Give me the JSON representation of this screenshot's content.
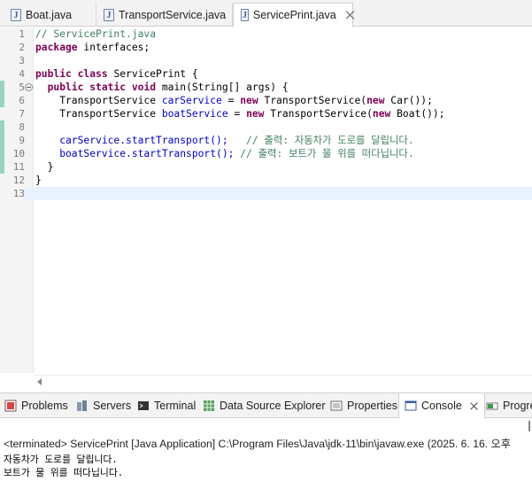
{
  "editor_tabs": [
    {
      "label": "Boat.java",
      "icon": "java-file-icon",
      "active": false
    },
    {
      "label": "TransportService.java",
      "icon": "java-file-icon",
      "active": false
    },
    {
      "label": "ServicePrint.java",
      "icon": "java-file-icon",
      "active": true
    }
  ],
  "java_icon_glyph": "J",
  "code": {
    "line_numbers": [
      "1",
      "2",
      "3",
      "4",
      "5",
      "6",
      "7",
      "8",
      "9",
      "10",
      "11",
      "12",
      "13"
    ],
    "lines": [
      "// ServicePrint.java",
      "package interfaces;",
      "",
      "public class ServicePrint {",
      "  public static void main(String[] args) {",
      "    TransportService carService = new TransportService(new Car());",
      "    TransportService boatService = new TransportService(new Boat());",
      "",
      "    carService.startTransport();   // 출력: 자동차가 도로를 달립니다.",
      "    boatService.startTransport(); // 출력: 보트가 물 위를 떠다닙니다.",
      "  }",
      "}",
      ""
    ],
    "tokens": {
      "l1_comment": "// ServicePrint.java",
      "l2_kw": "package",
      "l2_rest": " interfaces;",
      "l4_kw1": "public",
      "l4_kw2": "class",
      "l4_rest": " ServicePrint {",
      "l5_indent": "  ",
      "l5_kw1": "public",
      "l5_kw2": "static",
      "l5_kw3": "void",
      "l5_rest": " main(String[] args) {",
      "l6_a": "    TransportService ",
      "l6_var": "carService",
      "l6_b": " = ",
      "l6_kw": "new",
      "l6_c": " TransportService(",
      "l6_kw2": "new",
      "l6_d": " Car());",
      "l7_a": "    TransportService ",
      "l7_var": "boatService",
      "l7_b": " = ",
      "l7_kw": "new",
      "l7_c": " TransportService(",
      "l7_kw2": "new",
      "l7_d": " Boat());",
      "l9_a": "    carService.startTransport();   ",
      "l9_cm": "// 출력: 자동차가 도로를 달립니다.",
      "l10_a": "    boatService.startTransport(); ",
      "l10_cm": "// 출력: 보트가 물 위를 떠다닙니다.",
      "l11": "  }",
      "l12": "}"
    }
  },
  "view_tabs": [
    {
      "label": "Problems",
      "icon": "problems-icon"
    },
    {
      "label": "Servers",
      "icon": "servers-icon"
    },
    {
      "label": "Terminal",
      "icon": "terminal-icon"
    },
    {
      "label": "Data Source Explorer",
      "icon": "data-source-icon"
    },
    {
      "label": "Properties",
      "icon": "properties-icon"
    },
    {
      "label": "Console",
      "icon": "console-icon",
      "active": true
    },
    {
      "label": "Progre",
      "icon": "progress-icon"
    }
  ],
  "console": {
    "status": "<terminated> ServicePrint [Java Application] C:\\Program Files\\Java\\jdk-11\\bin\\javaw.exe  (2025. 6. 16. 오후",
    "output": [
      "자동차가 도로를 달립니다.",
      "보트가 물 위를 떠다닙니다."
    ]
  },
  "colors": {
    "keyword": "#7f0055",
    "comment": "#3f7f5f",
    "field": "#0000c0",
    "current_line": "#e8f2fe",
    "change_bar": "#9ad2c4"
  }
}
